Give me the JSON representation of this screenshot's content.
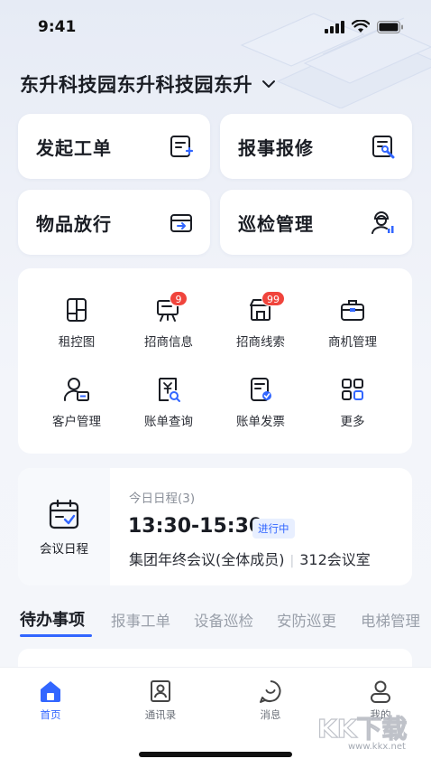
{
  "status_bar": {
    "time": "9:41"
  },
  "header": {
    "park_name": "东升科技园东升科技园东升"
  },
  "quick_actions": [
    {
      "label": "发起工单",
      "icon": "create-ticket-icon"
    },
    {
      "label": "报事报修",
      "icon": "repair-report-icon"
    },
    {
      "label": "物品放行",
      "icon": "item-release-icon"
    },
    {
      "label": "巡检管理",
      "icon": "inspector-icon"
    }
  ],
  "grid": [
    {
      "label": "租控图",
      "icon": "floor-plan-icon"
    },
    {
      "label": "招商信息",
      "icon": "billboard-icon",
      "badge": "9"
    },
    {
      "label": "招商线索",
      "icon": "shop-icon",
      "badge": "99"
    },
    {
      "label": "商机管理",
      "icon": "briefcase-icon"
    },
    {
      "label": "客户管理",
      "icon": "customer-icon"
    },
    {
      "label": "账单查询",
      "icon": "bill-search-icon"
    },
    {
      "label": "账单发票",
      "icon": "invoice-icon"
    },
    {
      "label": "更多",
      "icon": "more-grid-icon"
    }
  ],
  "schedule": {
    "section_label": "会议日程",
    "count_label": "今日日程(3)",
    "time_range": "13:30-15:30",
    "status": "进行中",
    "meeting_name": "集团年终会议(全体成员)",
    "room": "312会议室"
  },
  "tabs": [
    "待办事项",
    "报事工单",
    "设备巡检",
    "安防巡更",
    "电梯管理"
  ],
  "nav": [
    {
      "label": "首页",
      "icon": "home-icon"
    },
    {
      "label": "通讯录",
      "icon": "contacts-icon"
    },
    {
      "label": "消息",
      "icon": "message-icon"
    },
    {
      "label": "我的",
      "icon": "profile-icon"
    }
  ],
  "watermark": {
    "text": "KK下载",
    "url": "www.kkx.net"
  },
  "colors": {
    "accent": "#3266ff",
    "badge": "#f0443c",
    "text": "#1a1d24"
  }
}
